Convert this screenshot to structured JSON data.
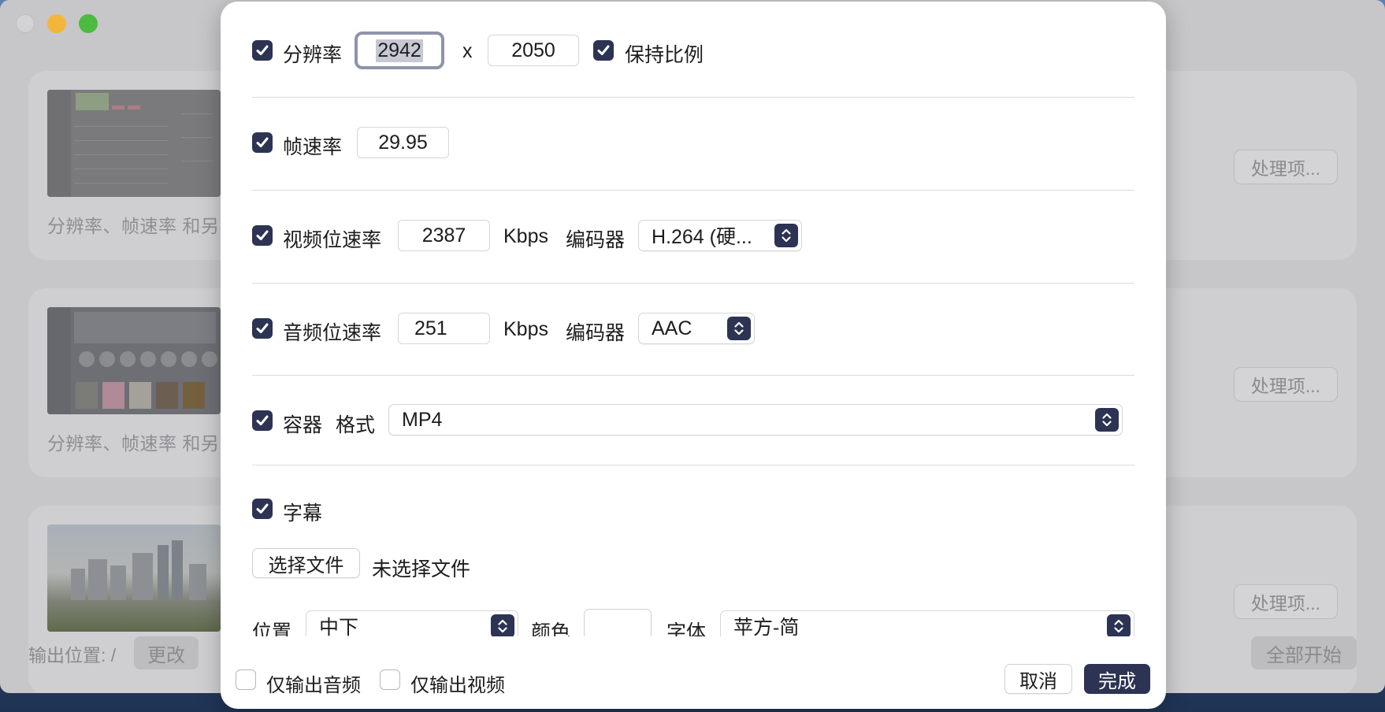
{
  "background": {
    "cards": [
      {
        "description": "分辨率、帧速率 和另",
        "process_button": "处理项..."
      },
      {
        "description": "分辨率、帧速率 和另",
        "process_button": "处理项..."
      },
      {
        "description": "",
        "process_button": "处理项..."
      }
    ],
    "footer": {
      "output_label": "输出位置: /",
      "change_button": "更改",
      "start_all_button": "全部开始"
    }
  },
  "dialog": {
    "resolution": {
      "label": "分辨率",
      "width": "2942",
      "separator": "x",
      "height": "2050",
      "keep_ratio_label": "保持比例",
      "checked": true,
      "keep_ratio_checked": true
    },
    "frame_rate": {
      "label": "帧速率",
      "value": "29.95",
      "checked": true
    },
    "video_bitrate": {
      "label": "视频位速率",
      "value": "2387",
      "unit": "Kbps",
      "encoder_label": "编码器",
      "encoder": "H.264 (硬...",
      "checked": true
    },
    "audio_bitrate": {
      "label": "音频位速率",
      "value": "251",
      "unit": "Kbps",
      "encoder_label": "编码器",
      "encoder": "AAC",
      "checked": true
    },
    "container": {
      "label": "容器",
      "format_label": "格式",
      "format": "MP4",
      "checked": true
    },
    "subtitles": {
      "label": "字幕",
      "checked": true,
      "choose_file_button": "选择文件",
      "file_status": "未选择文件",
      "position_label": "位置",
      "position": "中下",
      "color_label": "颜色",
      "font_label": "字体",
      "font": "苹方-简"
    },
    "footer": {
      "audio_only_label": "仅输出音频",
      "audio_only_checked": false,
      "video_only_label": "仅输出视频",
      "video_only_checked": false,
      "cancel_button": "取消",
      "done_button": "完成"
    }
  },
  "colors": {
    "accent": "#2c3353",
    "window_bg": "#c7c7c9",
    "card_bg": "#cfcfd1",
    "dialog_bg": "#ffffff"
  }
}
